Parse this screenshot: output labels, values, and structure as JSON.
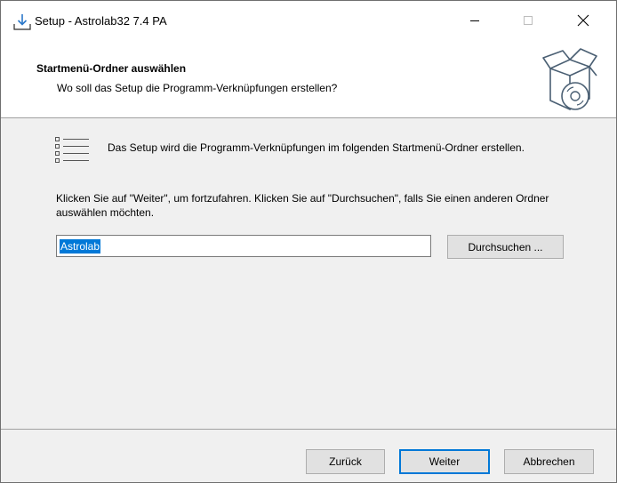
{
  "window": {
    "title": "Setup - Astrolab32 7.4 PA",
    "controls": [
      "minimize-icon",
      "maximize-icon",
      "close-icon"
    ]
  },
  "header": {
    "title": "Startmenü-Ordner auswählen",
    "subtitle": "Wo soll das Setup die Programm-Verknüpfungen erstellen?",
    "icon": "setup-box-disc-icon"
  },
  "body": {
    "icon": "list-icon",
    "intro": "Das Setup wird die Programm-Verknüpfungen im folgenden Startmenü-Ordner erstellen.",
    "hint": "Klicken Sie auf \"Weiter\", um fortzufahren. Klicken Sie auf \"Durchsuchen\", falls Sie einen anderen Ordner auswählen möchten.",
    "folder_value": "Astrolab",
    "browse_label": "Durchsuchen ..."
  },
  "footer": {
    "back_label": "Zurück",
    "next_label": "Weiter",
    "cancel_label": "Abbrechen"
  },
  "colors": {
    "selection": "#0078d7",
    "dialog_bg": "#f0f0f0",
    "button_bg": "#e1e1e1"
  }
}
